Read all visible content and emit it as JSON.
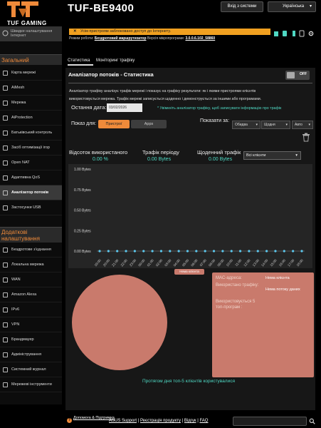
{
  "header": {
    "brand_text": "TUF GAMING",
    "model": "TUF-BE9400",
    "logout_label": "Вхід з системи",
    "language": "Українська",
    "alert": "Усім пристроям заблоковано доступ до Інтернету.",
    "opmode_prefix": "Режим роботи:",
    "opmode_link": "Бездротовий маршрутизатор",
    "firmware_prefix": "Версія мікропрограми:",
    "firmware_link": "3.0.0.6.102_58860"
  },
  "sidebar": {
    "quick_setup": "Швидке налаштування Інтернет",
    "general_title": "Загальний",
    "general_items": [
      "Карта мережі",
      "AiMesh",
      "Мережа",
      "AiProtection",
      "Батьківський контроль",
      "Засіб оптимізації ігор",
      "Open NAT",
      "Адаптивна QoS",
      "Аналізатор потоків",
      "Застосунки USB"
    ],
    "advanced_title": "Додаткові налаштування",
    "advanced_items": [
      "Бездротове з'єднання",
      "Локальна мережа",
      "WAN",
      "Amazon Alexa",
      "IPv6",
      "VPN",
      "Брандмауер",
      "Адміністрування",
      "Системний журнал",
      "Мережеві інструменти"
    ]
  },
  "tabs": [
    "Статистика",
    "Моніторинг трафіку"
  ],
  "main": {
    "title": "Аналізатор потоків - Статистика",
    "toggle": "OFF",
    "desc_line1": "Аналізатор трафіку аналізує трафік мережі і показує на графіку результати: як і якими пристроями клієнтів",
    "desc_line2": "використовується мережа. Трафік мережі записується щоденно і демонструється за іншими або програмами.",
    "date_label": "Остання дата:",
    "date_value": "03/02/2026",
    "date_hint": "* Увімкніть аналізатор трафіку, щоб записувати інформацію про трафік",
    "show_for_label": "Показ для:",
    "btn_devices": "Пристрої",
    "btn_apps": "Apps",
    "show_label": "Показати за:",
    "sel_direction": "Обидва",
    "sel_period": "Щодня",
    "sel_auto": "Авто"
  },
  "stats": {
    "used_label": "Відсоток використаного",
    "used_value": "0.00 %",
    "period_label": "Трафік періоду",
    "period_value": "0.00 Bytes",
    "daily_label": "Щоденний трафік",
    "daily_value": "0.00 Bytes",
    "clients_select": "Всі клієнти"
  },
  "chart_data": {
    "type": "line",
    "y_ticks": [
      "1.00 Bytes",
      "0.75 Bytes",
      "0.50 Bytes",
      "0.25 Bytes",
      "0.00 Bytes"
    ],
    "ylim": [
      0,
      1
    ],
    "x": [
      "19:00",
      "20:00",
      "21:00",
      "22:00",
      "23:00",
      "00:00",
      "01:00",
      "02:00",
      "03:00",
      "04:00",
      "05:00",
      "06:00",
      "07:00",
      "08:00",
      "09:00",
      "10:00",
      "11:00",
      "12:00",
      "13:00",
      "14:00",
      "15:00",
      "16:00",
      "17:00",
      "18:00"
    ],
    "series": [
      {
        "values": [
          0,
          0,
          0,
          0,
          0,
          0,
          0,
          0,
          0,
          0,
          0,
          0,
          0,
          0,
          0,
          0,
          0,
          0,
          0,
          0,
          0,
          0,
          0,
          0
        ]
      }
    ],
    "grid": false,
    "colors": {
      "point": "#5cc8ee",
      "axis": "#888888"
    }
  },
  "pie": {
    "label": "Нема клієнта",
    "value": 100,
    "color": "#c97a6c"
  },
  "info": {
    "mac_label": "MAC-адреса:",
    "mac_value": "Нема клієнта",
    "traffic_label": "Використано трафіку:",
    "traffic_value": "Нема потоку даних",
    "top5_label": "Використовується 5 топ-програм :",
    "caption": "Протягом дня топ-5 клієнтів користувалися"
  },
  "footer": {
    "help": "Допомога & Підтримка",
    "links": [
      "ASUS Support",
      "Реєстрація продукту",
      "Відгук",
      "FAQ"
    ]
  },
  "colors": {
    "accent": "#ef8a3a",
    "teal": "#4fd8c3",
    "pie": "#c97a6c"
  }
}
